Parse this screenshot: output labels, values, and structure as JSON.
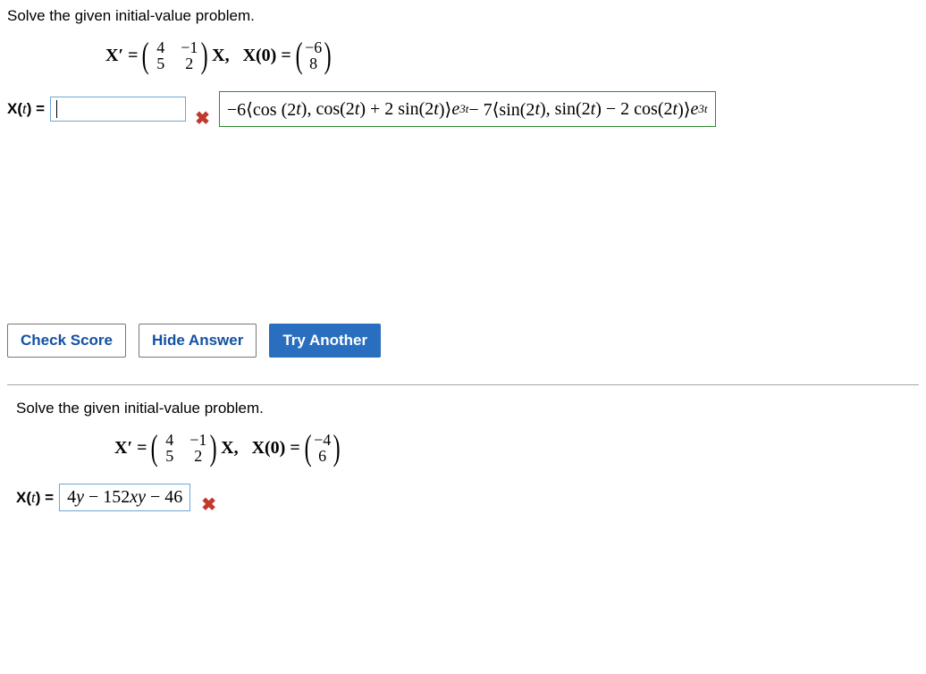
{
  "problem1": {
    "prompt": "Solve the given initial-value problem.",
    "eq_lhs": "X′ =",
    "matrix": [
      [
        "4",
        "−1"
      ],
      [
        "5",
        "2"
      ]
    ],
    "eq_mid": "X,   X(0) =",
    "vec": [
      "−6",
      "8"
    ],
    "answer_label": "X(t) =",
    "input_value": "",
    "solution": "−6⟨cos(2t), cos(2t) + 2 sin(2t)⟩e³ᵗ − 7⟨sin(2t), sin(2t) − 2 cos(2t)⟩e³ᵗ",
    "solution_parts": {
      "a": "−6⟨cos (2",
      "b": "), cos(2",
      "c": ") + 2 sin(2",
      "d": ")⟩",
      "e": " − 7⟨sin(2",
      "f": "), sin(2",
      "g": ") − 2 cos(2",
      "h": ")⟩"
    }
  },
  "buttons": {
    "check": "Check Score",
    "hide": "Hide Answer",
    "try": "Try Another"
  },
  "problem2": {
    "prompt": "Solve the given initial-value problem.",
    "eq_lhs": "X′ =",
    "matrix": [
      [
        "4",
        "−1"
      ],
      [
        "5",
        "2"
      ]
    ],
    "eq_mid": "X,   X(0) =",
    "vec": [
      "−4",
      "6"
    ],
    "answer_label": "X(t) =",
    "input_value": "4y − 152xy − 46"
  },
  "icons": {
    "wrong": "✖"
  }
}
